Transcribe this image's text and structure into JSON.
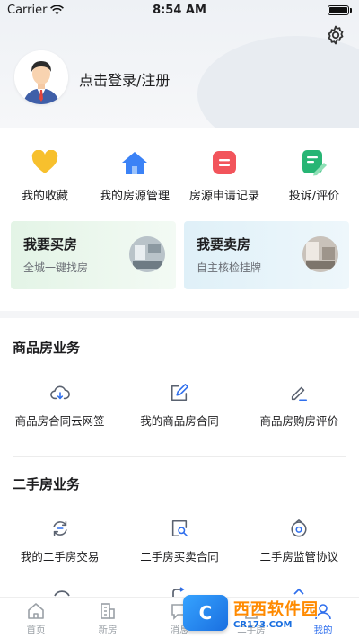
{
  "status_bar": {
    "carrier": "Carrier",
    "time": "8:54 AM"
  },
  "header": {
    "login_text": "点击登录/注册"
  },
  "quick_actions": [
    {
      "label": "我的收藏",
      "icon": "heart-icon",
      "color": "#f7c02d"
    },
    {
      "label": "我的房源管理",
      "icon": "home-icon",
      "color": "#3b82f6"
    },
    {
      "label": "房源申请记录",
      "icon": "record-icon",
      "color": "#f2545b"
    },
    {
      "label": "投诉/评价",
      "icon": "feedback-icon",
      "color": "#27b574"
    }
  ],
  "promos": {
    "buy": {
      "title": "我要买房",
      "subtitle": "全城一键找房"
    },
    "sell": {
      "title": "我要卖房",
      "subtitle": "自主核检挂牌"
    }
  },
  "commercial": {
    "title": "商品房业务",
    "items": [
      {
        "label": "商品房合同云网签",
        "icon": "cloud-sign-icon"
      },
      {
        "label": "我的商品房合同",
        "icon": "contract-edit-icon"
      },
      {
        "label": "商品房购房评价",
        "icon": "review-pen-icon"
      }
    ]
  },
  "second_hand": {
    "title": "二手房业务",
    "items": [
      {
        "label": "我的二手房交易",
        "icon": "exchange-icon"
      },
      {
        "label": "二手房买卖合同",
        "icon": "search-doc-icon"
      },
      {
        "label": "二手房监管协议",
        "icon": "supervision-icon"
      }
    ]
  },
  "tabbar": [
    {
      "label": "首页",
      "icon": "home-tab-icon",
      "active": false
    },
    {
      "label": "新房",
      "icon": "building-tab-icon",
      "active": false
    },
    {
      "label": "消息",
      "icon": "message-tab-icon",
      "active": false
    },
    {
      "label": "二手房",
      "icon": "house-tab-icon",
      "active": false
    },
    {
      "label": "我的",
      "icon": "profile-tab-icon",
      "active": true
    }
  ],
  "watermark": {
    "main": "西西软件园",
    "sub": "CR173.COM"
  },
  "colors": {
    "accent": "#2f6fed",
    "icon_stroke": "#5a6270"
  }
}
